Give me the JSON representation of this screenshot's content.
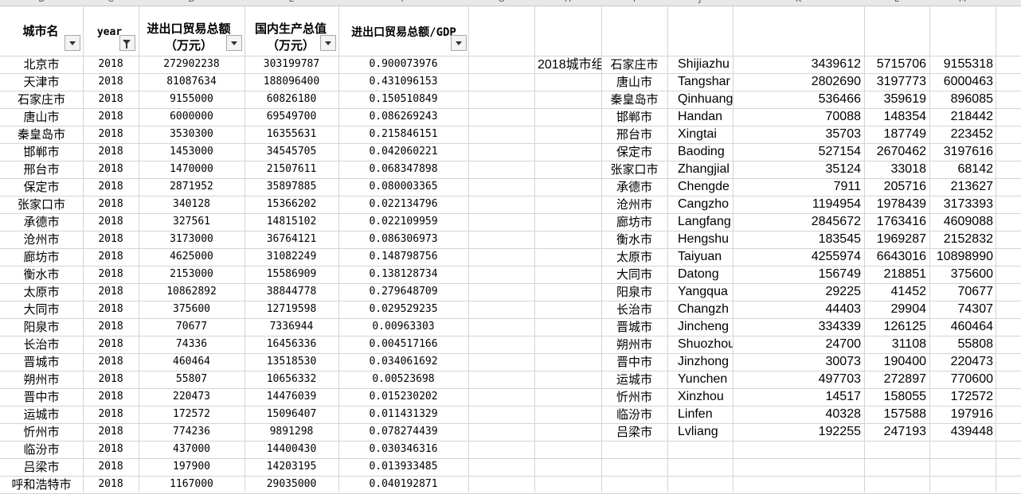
{
  "sheet": {
    "column_letters": [
      "B",
      "C",
      "D",
      "E",
      "F",
      "G",
      "H",
      "I",
      "J",
      "K",
      "L",
      "M"
    ],
    "header": {
      "city": "城市名",
      "year": "year",
      "trade_line1": "进出口贸易总额",
      "trade_line2": "（万元）",
      "gdp_line1": "国内生产总值",
      "gdp_line2": "（万元）",
      "ratio": "进出口贸易总额/GDP"
    },
    "side_label": "2018城市组",
    "left_rows": [
      [
        "北京市",
        "2018",
        "272902238",
        "303199787",
        "0.900073976"
      ],
      [
        "天津市",
        "2018",
        "81087634",
        "188096400",
        "0.431096153"
      ],
      [
        "石家庄市",
        "2018",
        "9155000",
        "60826180",
        "0.150510849"
      ],
      [
        "唐山市",
        "2018",
        "6000000",
        "69549700",
        "0.086269243"
      ],
      [
        "秦皇岛市",
        "2018",
        "3530300",
        "16355631",
        "0.215846151"
      ],
      [
        "邯郸市",
        "2018",
        "1453000",
        "34545705",
        "0.042060221"
      ],
      [
        "邢台市",
        "2018",
        "1470000",
        "21507611",
        "0.068347898"
      ],
      [
        "保定市",
        "2018",
        "2871952",
        "35897885",
        "0.080003365"
      ],
      [
        "张家口市",
        "2018",
        "340128",
        "15366202",
        "0.022134796"
      ],
      [
        "承德市",
        "2018",
        "327561",
        "14815102",
        "0.022109959"
      ],
      [
        "沧州市",
        "2018",
        "3173000",
        "36764121",
        "0.086306973"
      ],
      [
        "廊坊市",
        "2018",
        "4625000",
        "31082249",
        "0.148798756"
      ],
      [
        "衡水市",
        "2018",
        "2153000",
        "15586909",
        "0.138128734"
      ],
      [
        "太原市",
        "2018",
        "10862892",
        "38844778",
        "0.279648709"
      ],
      [
        "大同市",
        "2018",
        "375600",
        "12719598",
        "0.029529235"
      ],
      [
        "阳泉市",
        "2018",
        "70677",
        "7336944",
        "0.00963303"
      ],
      [
        "长治市",
        "2018",
        "74336",
        "16456336",
        "0.004517166"
      ],
      [
        "晋城市",
        "2018",
        "460464",
        "13518530",
        "0.034061692"
      ],
      [
        "朔州市",
        "2018",
        "55807",
        "10656332",
        "0.00523698"
      ],
      [
        "晋中市",
        "2018",
        "220473",
        "14476039",
        "0.015230202"
      ],
      [
        "运城市",
        "2018",
        "172572",
        "15096407",
        "0.011431329"
      ],
      [
        "忻州市",
        "2018",
        "774236",
        "9891298",
        "0.078274439"
      ],
      [
        "临汾市",
        "2018",
        "437000",
        "14400430",
        "0.030346316"
      ],
      [
        "吕梁市",
        "2018",
        "197900",
        "14203195",
        "0.013933485"
      ],
      [
        "呼和浩特市",
        "2018",
        "1167000",
        "29035000",
        "0.040192871"
      ]
    ],
    "right_rows": [
      [
        "石家庄市",
        "Shijiazhu",
        "3439612",
        "5715706",
        "9155318"
      ],
      [
        "唐山市",
        "Tangshar",
        "2802690",
        "3197773",
        "6000463"
      ],
      [
        "秦皇岛市",
        "Qinhuang",
        "536466",
        "359619",
        "896085"
      ],
      [
        "邯郸市",
        "Handan",
        "70088",
        "148354",
        "218442"
      ],
      [
        "邢台市",
        "Xingtai",
        "35703",
        "187749",
        "223452"
      ],
      [
        "保定市",
        "Baoding",
        "527154",
        "2670462",
        "3197616"
      ],
      [
        "张家口市",
        "Zhangjial",
        "35124",
        "33018",
        "68142"
      ],
      [
        "承德市",
        "Chengde",
        "7911",
        "205716",
        "213627"
      ],
      [
        "沧州市",
        "Cangzho",
        "1194954",
        "1978439",
        "3173393"
      ],
      [
        "廊坊市",
        "Langfang",
        "2845672",
        "1763416",
        "4609088"
      ],
      [
        "衡水市",
        "Hengshu",
        "183545",
        "1969287",
        "2152832"
      ],
      [
        "太原市",
        "Taiyuan",
        "4255974",
        "6643016",
        "10898990"
      ],
      [
        "大同市",
        "Datong",
        "156749",
        "218851",
        "375600"
      ],
      [
        "阳泉市",
        "Yangqua",
        "29225",
        "41452",
        "70677"
      ],
      [
        "长治市",
        "Changzh",
        "44403",
        "29904",
        "74307"
      ],
      [
        "晋城市",
        "Jincheng",
        "334339",
        "126125",
        "460464"
      ],
      [
        "朔州市",
        "Shuozhou",
        "24700",
        "31108",
        "55808"
      ],
      [
        "晋中市",
        "Jinzhong",
        "30073",
        "190400",
        "220473"
      ],
      [
        "运城市",
        "Yunchen",
        "497703",
        "272897",
        "770600"
      ],
      [
        "忻州市",
        "Xinzhou",
        "14517",
        "158055",
        "172572"
      ],
      [
        "临汾市",
        "Linfen",
        "40328",
        "157588",
        "197916"
      ],
      [
        "吕梁市",
        "Lvliang",
        "192255",
        "247193",
        "439448"
      ]
    ]
  }
}
